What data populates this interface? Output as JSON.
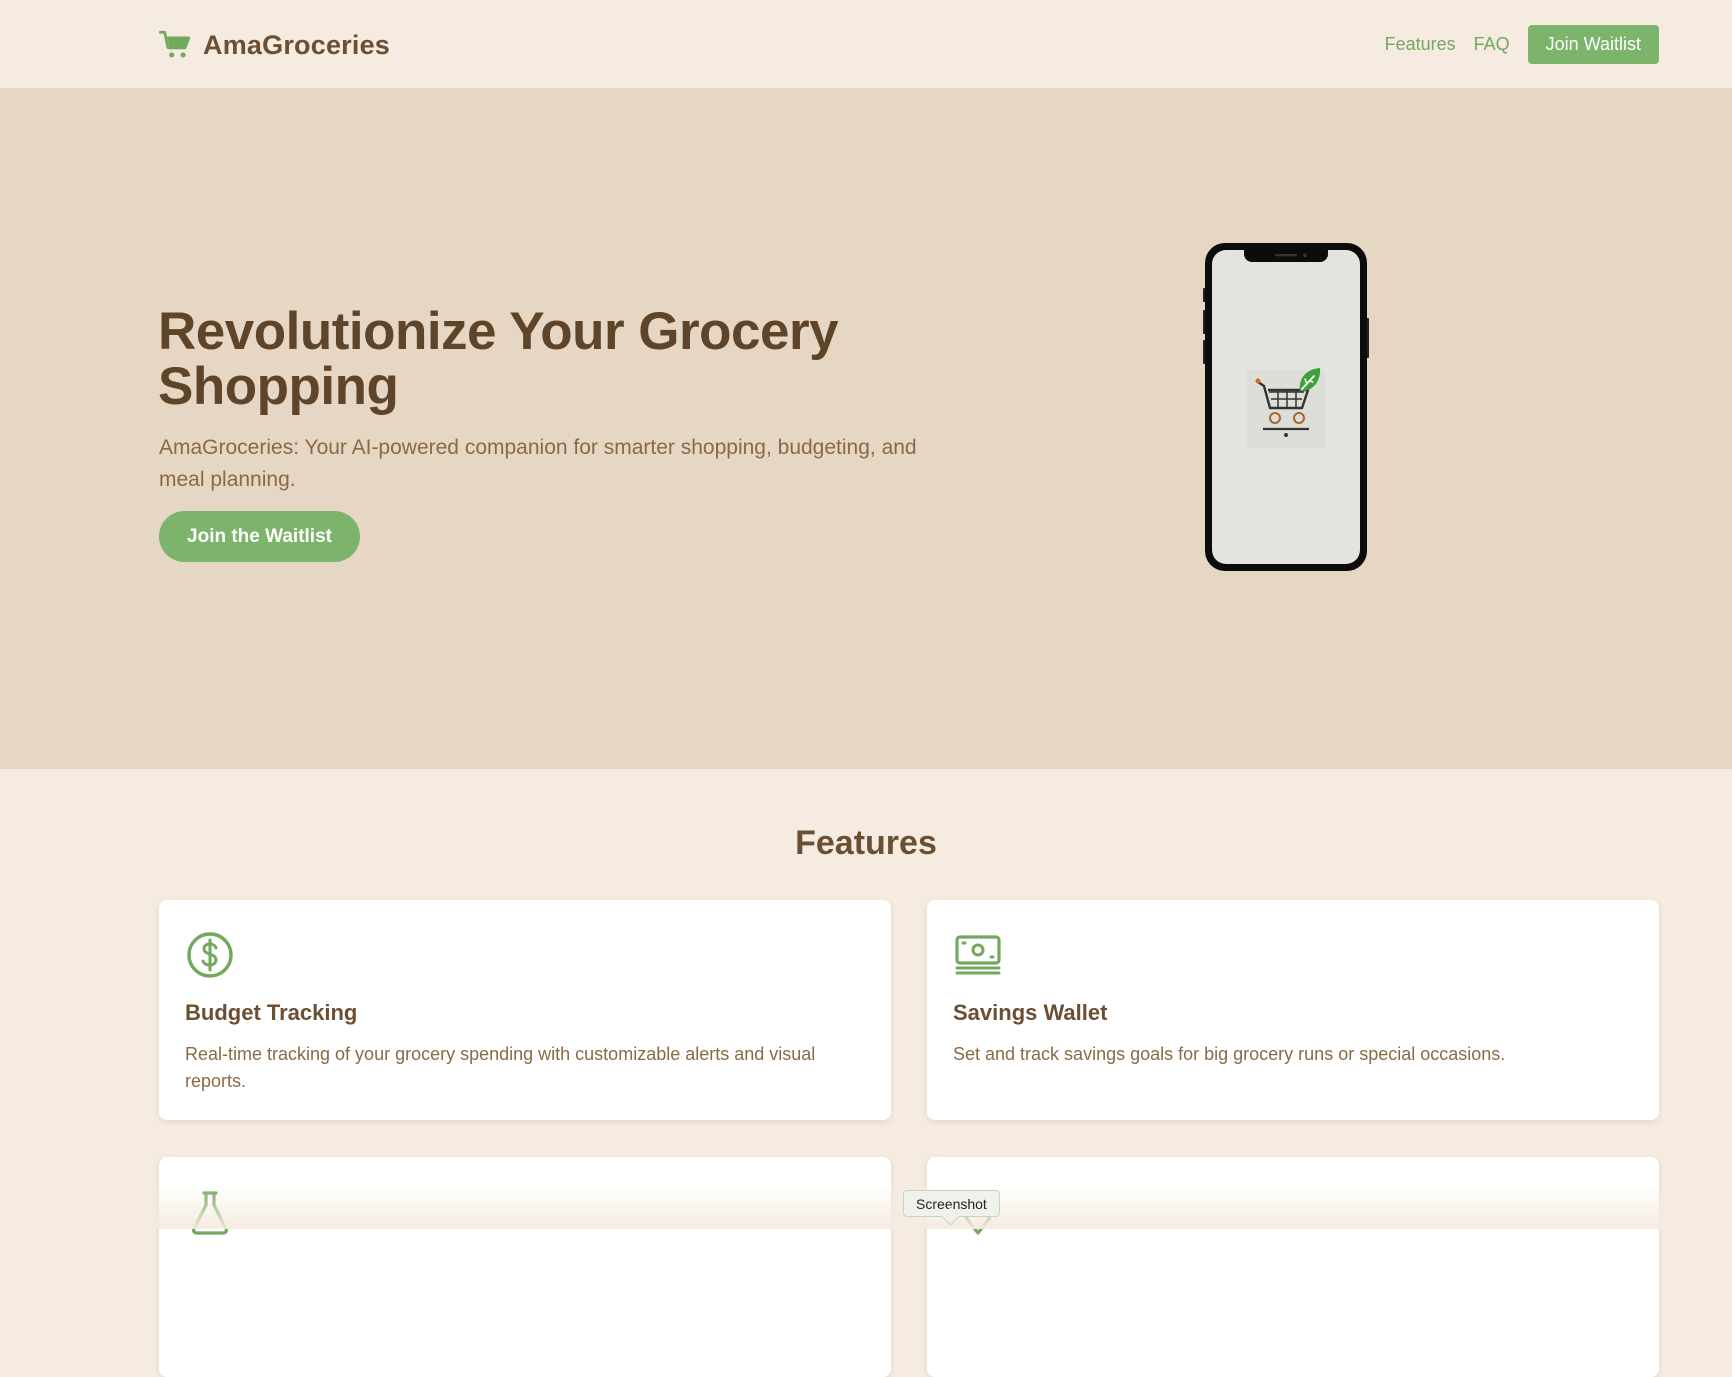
{
  "header": {
    "brand_name": "AmaGroceries",
    "brand_icon": "shopping-cart-icon",
    "nav": {
      "features_label": "Features",
      "faq_label": "FAQ",
      "cta_label": "Join Waitlist"
    }
  },
  "hero": {
    "title": "Revolutionize Your Grocery Shopping",
    "subtitle": "AmaGroceries: Your AI-powered companion for smarter shopping, budgeting, and meal planning.",
    "cta_label": "Join the Waitlist",
    "phone_screen_icon": "cart-with-leaf-icon"
  },
  "features": {
    "title": "Features",
    "cards": [
      {
        "icon": "dollar-circle-icon",
        "title": "Budget Tracking",
        "description": "Real-time tracking of your grocery spending with customizable alerts and visual reports."
      },
      {
        "icon": "cash-bills-icon",
        "title": "Savings Wallet",
        "description": "Set and track savings goals for big grocery runs or special occasions."
      },
      {
        "icon": "flask-icon",
        "title": "",
        "description": ""
      },
      {
        "icon": "map-pin-icon",
        "title": "",
        "description": ""
      }
    ]
  },
  "tooltip": {
    "label": "Screenshot"
  },
  "colors": {
    "accent_green": "#7bb46a",
    "brown_text": "#5e4529",
    "hero_bg": "#e6d6c4",
    "page_bg": "#f5ebe0"
  }
}
